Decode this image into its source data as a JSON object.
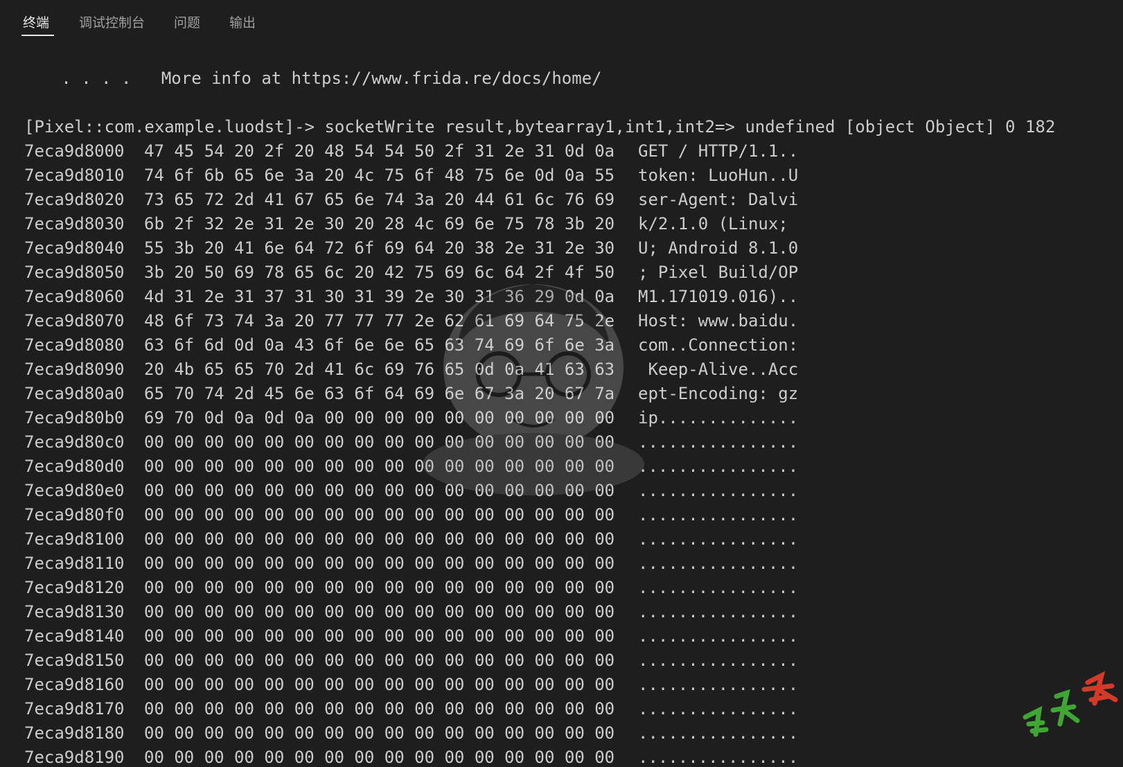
{
  "tabs": [
    {
      "label": "终端",
      "active": true
    },
    {
      "label": "调试控制台",
      "active": false
    },
    {
      "label": "问题",
      "active": false
    },
    {
      "label": "输出",
      "active": false
    }
  ],
  "terminal": {
    "info_line": "   . . . .   More info at https://www.frida.re/docs/home/",
    "command_line": "[Pixel::com.example.luodst]-> socketWrite result,bytearray1,int1,int2=> undefined [object Object] 0 182",
    "dump_rows": [
      {
        "addr": "7eca9d8000",
        "hex": "47 45 54 20 2f 20 48 54 54 50 2f 31 2e 31 0d 0a",
        "ascii": "GET / HTTP/1.1.."
      },
      {
        "addr": "7eca9d8010",
        "hex": "74 6f 6b 65 6e 3a 20 4c 75 6f 48 75 6e 0d 0a 55",
        "ascii": "token: LuoHun..U"
      },
      {
        "addr": "7eca9d8020",
        "hex": "73 65 72 2d 41 67 65 6e 74 3a 20 44 61 6c 76 69",
        "ascii": "ser-Agent: Dalvi"
      },
      {
        "addr": "7eca9d8030",
        "hex": "6b 2f 32 2e 31 2e 30 20 28 4c 69 6e 75 78 3b 20",
        "ascii": "k/2.1.0 (Linux;"
      },
      {
        "addr": "7eca9d8040",
        "hex": "55 3b 20 41 6e 64 72 6f 69 64 20 38 2e 31 2e 30",
        "ascii": "U; Android 8.1.0"
      },
      {
        "addr": "7eca9d8050",
        "hex": "3b 20 50 69 78 65 6c 20 42 75 69 6c 64 2f 4f 50",
        "ascii": "; Pixel Build/OP"
      },
      {
        "addr": "7eca9d8060",
        "hex": "4d 31 2e 31 37 31 30 31 39 2e 30 31 36 29 0d 0a",
        "ascii": "M1.171019.016).."
      },
      {
        "addr": "7eca9d8070",
        "hex": "48 6f 73 74 3a 20 77 77 77 2e 62 61 69 64 75 2e",
        "ascii": "Host: www.baidu."
      },
      {
        "addr": "7eca9d8080",
        "hex": "63 6f 6d 0d 0a 43 6f 6e 6e 65 63 74 69 6f 6e 3a",
        "ascii": "com..Connection:"
      },
      {
        "addr": "7eca9d8090",
        "hex": "20 4b 65 65 70 2d 41 6c 69 76 65 0d 0a 41 63 63",
        "ascii": " Keep-Alive..Acc"
      },
      {
        "addr": "7eca9d80a0",
        "hex": "65 70 74 2d 45 6e 63 6f 64 69 6e 67 3a 20 67 7a",
        "ascii": "ept-Encoding: gz"
      },
      {
        "addr": "7eca9d80b0",
        "hex": "69 70 0d 0a 0d 0a 00 00 00 00 00 00 00 00 00 00",
        "ascii": "ip.............."
      },
      {
        "addr": "7eca9d80c0",
        "hex": "00 00 00 00 00 00 00 00 00 00 00 00 00 00 00 00",
        "ascii": "................"
      },
      {
        "addr": "7eca9d80d0",
        "hex": "00 00 00 00 00 00 00 00 00 00 00 00 00 00 00 00",
        "ascii": "................"
      },
      {
        "addr": "7eca9d80e0",
        "hex": "00 00 00 00 00 00 00 00 00 00 00 00 00 00 00 00",
        "ascii": "................"
      },
      {
        "addr": "7eca9d80f0",
        "hex": "00 00 00 00 00 00 00 00 00 00 00 00 00 00 00 00",
        "ascii": "................"
      },
      {
        "addr": "7eca9d8100",
        "hex": "00 00 00 00 00 00 00 00 00 00 00 00 00 00 00 00",
        "ascii": "................"
      },
      {
        "addr": "7eca9d8110",
        "hex": "00 00 00 00 00 00 00 00 00 00 00 00 00 00 00 00",
        "ascii": "................"
      },
      {
        "addr": "7eca9d8120",
        "hex": "00 00 00 00 00 00 00 00 00 00 00 00 00 00 00 00",
        "ascii": "................"
      },
      {
        "addr": "7eca9d8130",
        "hex": "00 00 00 00 00 00 00 00 00 00 00 00 00 00 00 00",
        "ascii": "................"
      },
      {
        "addr": "7eca9d8140",
        "hex": "00 00 00 00 00 00 00 00 00 00 00 00 00 00 00 00",
        "ascii": "................"
      },
      {
        "addr": "7eca9d8150",
        "hex": "00 00 00 00 00 00 00 00 00 00 00 00 00 00 00 00",
        "ascii": "................"
      },
      {
        "addr": "7eca9d8160",
        "hex": "00 00 00 00 00 00 00 00 00 00 00 00 00 00 00 00",
        "ascii": "................"
      },
      {
        "addr": "7eca9d8170",
        "hex": "00 00 00 00 00 00 00 00 00 00 00 00 00 00 00 00",
        "ascii": "................"
      },
      {
        "addr": "7eca9d8180",
        "hex": "00 00 00 00 00 00 00 00 00 00 00 00 00 00 00 00",
        "ascii": "................"
      },
      {
        "addr": "7eca9d8190",
        "hex": "00 00 00 00 00 00 00 00 00 00 00 00 00 00 00 00",
        "ascii": "................"
      }
    ]
  },
  "colors": {
    "background": "#1e1e1e",
    "text": "#cccccc",
    "tab_active": "#e7e7e7",
    "tab_inactive": "#a0a0a0"
  }
}
